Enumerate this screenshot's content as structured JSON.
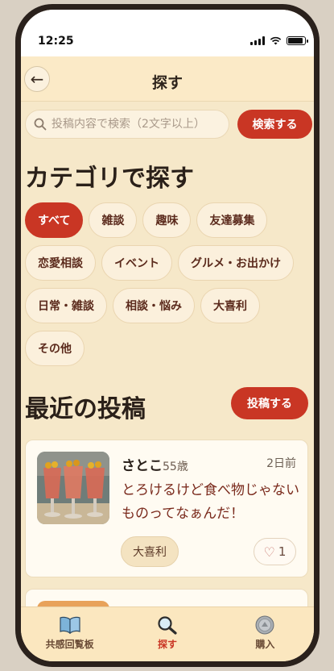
{
  "status_bar": {
    "time": "12:25",
    "battery_level": 0.9
  },
  "header": {
    "title": "探す",
    "back_icon": "back-arrow-icon"
  },
  "search": {
    "placeholder": "投稿内容で検索（2文字以上）",
    "button_label": "検索する"
  },
  "categories": {
    "heading": "カテゴリで探す",
    "items": [
      "すべて",
      "雑談",
      "趣味",
      "友達募集",
      "恋愛相談",
      "イベント",
      "グルメ・お出かけ",
      "日常・雑談",
      "相談・悩み",
      "大喜利",
      "その他"
    ],
    "selected": "すべて"
  },
  "recent": {
    "heading": "最近の投稿",
    "post_button_label": "投稿する",
    "posts": [
      {
        "author": "さとこ",
        "age": "55歳",
        "time_ago": "2日前",
        "text": "とろけるけど食べ物じゃないものってなぁんだ！",
        "category": "大喜利",
        "likes": "1"
      }
    ]
  },
  "tabbar": {
    "items": [
      {
        "label": "共感回覧板",
        "icon": "book-icon"
      },
      {
        "label": "探す",
        "icon": "magnifier-icon"
      },
      {
        "label": "購入",
        "icon": "coin-icon"
      }
    ],
    "active": "探す"
  },
  "colors": {
    "accent": "#c93624",
    "background": "#f6e8c9",
    "chip": "#fbf0dc"
  }
}
